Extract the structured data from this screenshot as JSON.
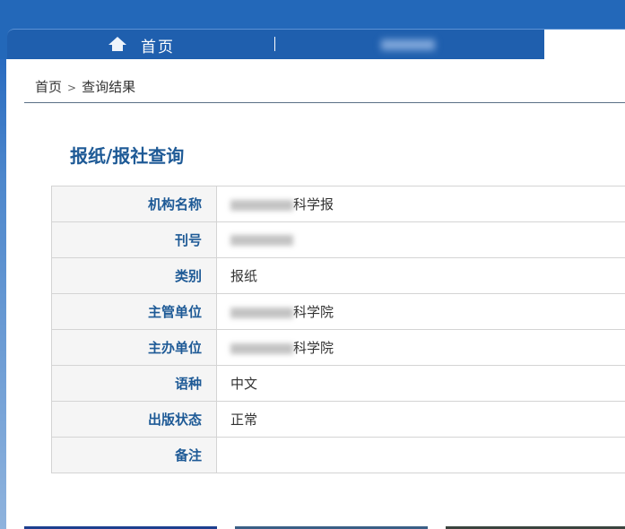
{
  "nav": {
    "home": "首页"
  },
  "breadcrumb": {
    "home": "首页",
    "sep": ">",
    "current": "查询结果"
  },
  "title": "报纸/报社查询",
  "rows": [
    {
      "label": "机构名称",
      "value": "科学报",
      "blurred": true
    },
    {
      "label": "刊号",
      "value": "",
      "blurred": true
    },
    {
      "label": "类别",
      "value": "报纸",
      "blurred": false
    },
    {
      "label": "主管单位",
      "value": "科学院",
      "blurred": true
    },
    {
      "label": "主办单位",
      "value": "科学院",
      "blurred": true
    },
    {
      "label": "语种",
      "value": "中文",
      "blurred": false
    },
    {
      "label": "出版状态",
      "value": "正常",
      "blurred": false
    },
    {
      "label": "备注",
      "value": "",
      "blurred": false
    }
  ]
}
